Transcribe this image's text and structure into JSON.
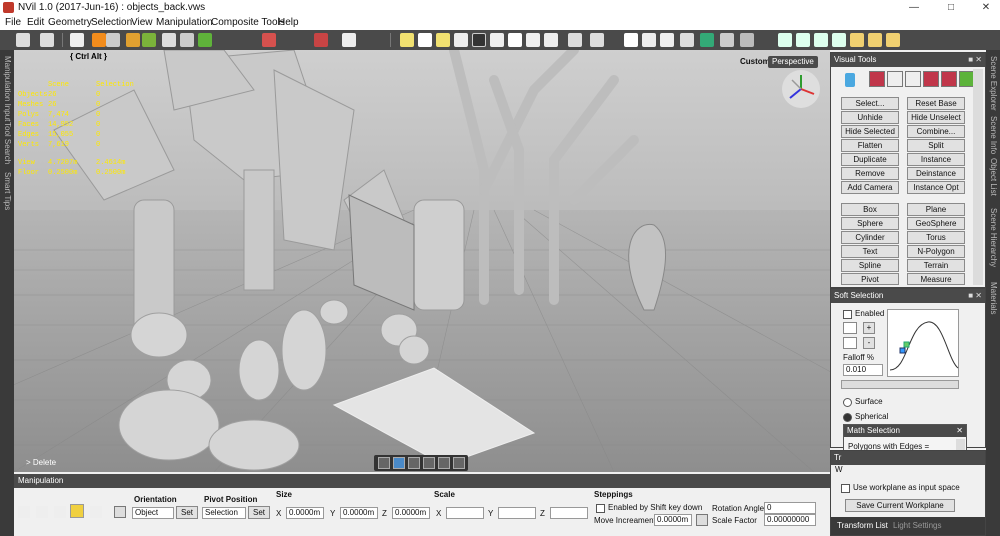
{
  "window": {
    "title": "NVil 1.0 (2017-Jun-16) : objects_back.vws"
  },
  "menu": [
    "File",
    "Edit",
    "Geometry",
    "Selection",
    "View",
    "Manipulation",
    "Composite Tools",
    "Help"
  ],
  "left_tabs": [
    "Manipulation Input",
    "Tool Search",
    "Smart Tips"
  ],
  "right_tabs": [
    "Scene Explorer",
    "Scene Info",
    "Object List",
    "Scene Hierarchy",
    "Materials"
  ],
  "viewport": {
    "shortcut_label": "{ Ctrl Alt }",
    "mode": "Custom",
    "camera": "Perspective",
    "hint": "> Delete",
    "stats": {
      "headers": [
        "",
        "Scene",
        "Selection"
      ],
      "rows": [
        [
          "Objects",
          "26",
          "0"
        ],
        [
          "Meshes",
          "26",
          "0"
        ],
        [
          "Polys",
          "7,474",
          "0"
        ],
        [
          "Faces",
          "14,952",
          "0"
        ],
        [
          "Edges",
          "15,055",
          "0"
        ],
        [
          "Verts",
          "7,619",
          "0"
        ],
        [
          "View",
          "4.7207m",
          "2.4614m"
        ],
        [
          "Floor",
          "0.2500m",
          "0.2500m"
        ]
      ]
    }
  },
  "visual_tools": {
    "title": "Visual Tools",
    "buttons": [
      [
        "Select...",
        "Reset Base"
      ],
      [
        "Unhide",
        "Hide Unselect"
      ],
      [
        "Hide Selected",
        "Combine..."
      ],
      [
        "Flatten",
        "Split"
      ],
      [
        "Duplicate",
        "Instance"
      ],
      [
        "Remove",
        "Deinstance"
      ],
      [
        "Add Camera",
        "Instance Opt"
      ],
      [
        "Box",
        "Plane"
      ],
      [
        "Sphere",
        "GeoSphere"
      ],
      [
        "Cylinder",
        "Torus"
      ],
      [
        "Text",
        "N-Polygon"
      ],
      [
        "Spline",
        "Terrain"
      ],
      [
        "Pivot",
        "Measure"
      ]
    ]
  },
  "soft_selection": {
    "title": "Soft Selection",
    "enabled_label": "Enabled",
    "falloff_label": "Falloff %",
    "falloff_value": "0.010",
    "surface_label": "Surface",
    "spherical_label": "Spherical"
  },
  "math_selection": {
    "title": "Math Selection",
    "value": "Polygons with Edges ="
  },
  "transform": {
    "title": "Tr",
    "field_value": "W",
    "use_workplane_label": "Use workplane as input space",
    "save_button": "Save Current Workplane",
    "tabs": [
      "Transform List",
      "Light Settings"
    ]
  },
  "manipulation": {
    "title": "Manipulation",
    "orientation_label": "Orientation",
    "orientation_value": "Object",
    "pivot_label": "Pivot Position",
    "pivot_value": "Selection",
    "set_label": "Set",
    "size_label": "Size",
    "scale_label": "Scale",
    "x_label": "X",
    "y_label": "Y",
    "z_label": "Z",
    "size_x": "0.0000m",
    "size_y": "0.0000m",
    "size_z": "0.0000m",
    "steppings_label": "Steppings",
    "shift_label": "Enabled by Shift key down",
    "move_inc_label": "Move Increament",
    "move_inc_value": "0.0000m",
    "rot_label": "Rotation Angle",
    "rot_value": "0",
    "scale_factor_label": "Scale Factor",
    "scale_factor_value": "0.00000000"
  }
}
